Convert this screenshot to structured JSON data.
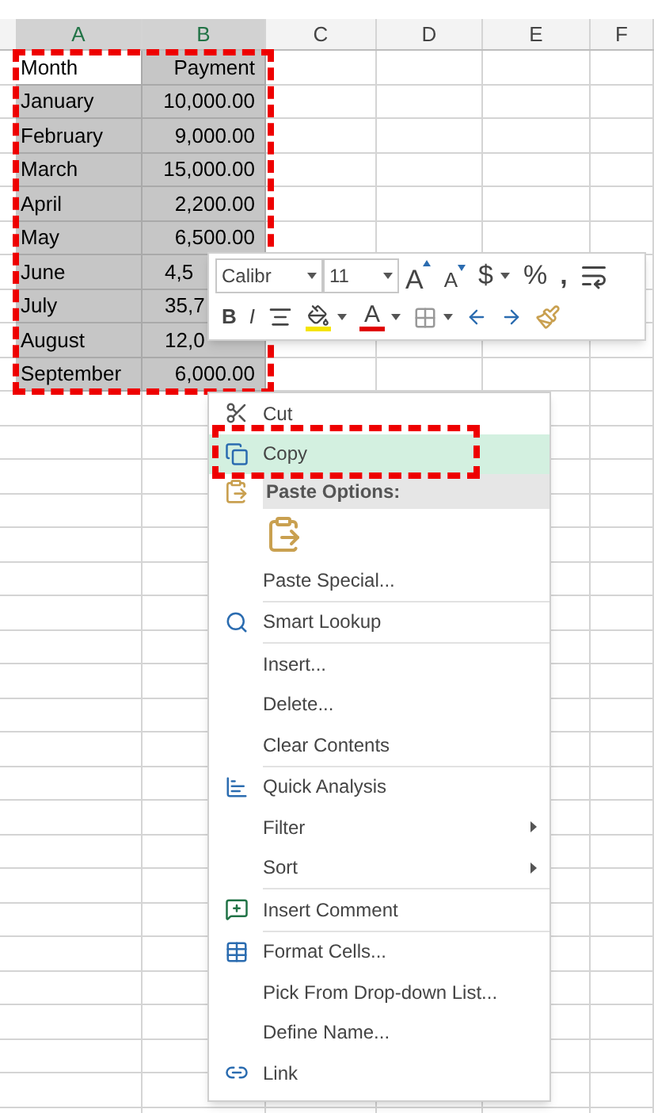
{
  "sheet": {
    "columns": [
      {
        "label": "A",
        "selected": true
      },
      {
        "label": "B",
        "selected": true
      },
      {
        "label": "C",
        "selected": false
      },
      {
        "label": "D",
        "selected": false
      },
      {
        "label": "E",
        "selected": false
      },
      {
        "label": "F",
        "selected": false
      }
    ],
    "rows": [
      [
        {
          "text": "Month",
          "active": true
        },
        {
          "text": "Payment",
          "active": false
        }
      ],
      [
        {
          "text": "January",
          "active": false
        },
        {
          "text": "10,000.00",
          "active": false
        }
      ],
      [
        {
          "text": "February",
          "active": false
        },
        {
          "text": "9,000.00",
          "active": false
        }
      ],
      [
        {
          "text": "March",
          "active": false
        },
        {
          "text": "15,000.00",
          "active": false
        }
      ],
      [
        {
          "text": "April",
          "active": false
        },
        {
          "text": "2,200.00",
          "active": false
        }
      ],
      [
        {
          "text": "May",
          "active": false
        },
        {
          "text": "6,500.00",
          "active": false
        }
      ],
      [
        {
          "text": "June",
          "active": false
        },
        {
          "text": "4,5",
          "active": false,
          "clipped": true
        }
      ],
      [
        {
          "text": "July",
          "active": false
        },
        {
          "text": "35,7",
          "active": false,
          "clipped": true
        }
      ],
      [
        {
          "text": "August",
          "active": false
        },
        {
          "text": "12,0",
          "active": false,
          "clipped": true
        }
      ],
      [
        {
          "text": "September",
          "active": false
        },
        {
          "text": "6,000.00",
          "active": false
        }
      ]
    ]
  },
  "mini_toolbar": {
    "font_name": "Calibr",
    "font_size": "11",
    "row_1": [
      {
        "kind": "grow",
        "label": "A"
      },
      {
        "kind": "shrink",
        "label": "A"
      },
      {
        "kind": "currency",
        "label": "$"
      },
      {
        "kind": "percent",
        "label": "%"
      },
      {
        "kind": "comma",
        "label": ","
      },
      {
        "kind": "wrap"
      }
    ],
    "row_2": [
      {
        "kind": "bold",
        "label": "B"
      },
      {
        "kind": "italic",
        "label": "I"
      },
      {
        "kind": "align"
      },
      {
        "kind": "fill"
      },
      {
        "kind": "font-color",
        "label": "A"
      },
      {
        "kind": "borders"
      },
      {
        "kind": "inc-decimal"
      },
      {
        "kind": "dec-decimal"
      },
      {
        "kind": "painter"
      }
    ]
  },
  "context_menu": {
    "items": [
      {
        "kind": "cut",
        "label": "Cut",
        "selected": false
      },
      {
        "kind": "copy",
        "label": "Copy",
        "selected": true
      },
      {
        "kind": "header",
        "label": "Paste Options:"
      },
      {
        "kind": "paste-buttons"
      },
      {
        "kind": "plain",
        "label": "Paste Special...",
        "divider": true
      },
      {
        "kind": "lookup",
        "label": "Smart Lookup",
        "divider": true
      },
      {
        "kind": "plain",
        "label": "Insert...",
        "divider": false
      },
      {
        "kind": "plain",
        "label": "Delete...",
        "divider": false
      },
      {
        "kind": "plain",
        "label": "Clear Contents",
        "divider": true
      },
      {
        "kind": "analysis",
        "label": "Quick Analysis",
        "divider": false
      },
      {
        "kind": "submenu",
        "label": "Filter",
        "divider": false
      },
      {
        "kind": "submenu",
        "label": "Sort",
        "divider": true
      },
      {
        "kind": "comment",
        "label": "Insert Comment",
        "divider": true
      },
      {
        "kind": "format",
        "label": "Format Cells...",
        "divider": false
      },
      {
        "kind": "plain",
        "label": "Pick From Drop-down List...",
        "divider": false
      },
      {
        "kind": "plain",
        "label": "Define Name...",
        "divider": false
      },
      {
        "kind": "link",
        "label": "Link",
        "divider": false
      }
    ]
  }
}
